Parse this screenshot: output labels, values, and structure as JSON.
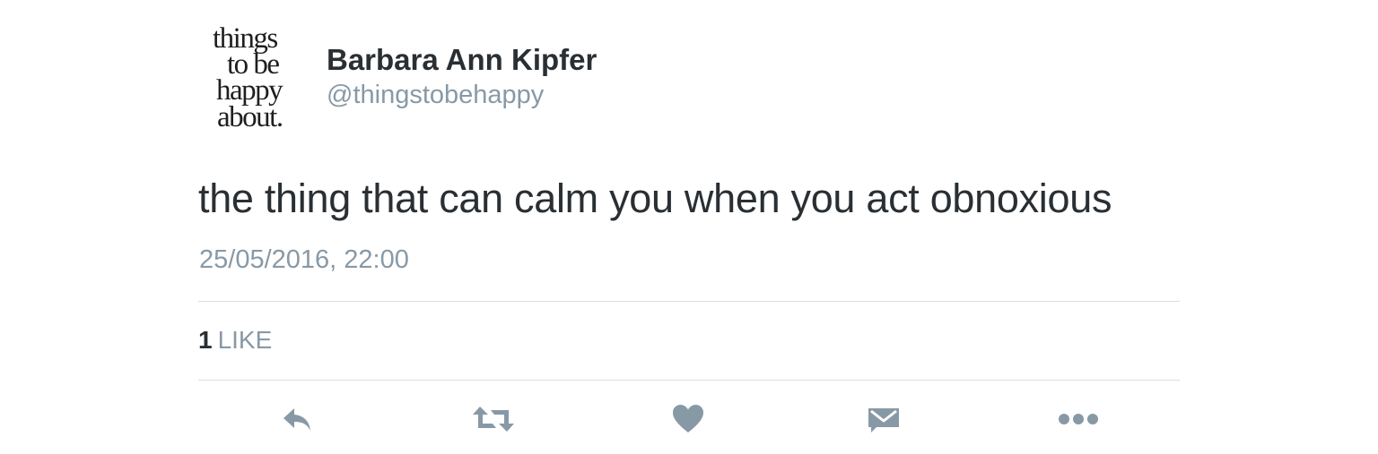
{
  "author": {
    "avatar_text": [
      "things",
      "to be",
      "happy",
      "about."
    ],
    "display_name": "Barbara Ann Kipfer",
    "handle": "@thingstobehappy"
  },
  "tweet": {
    "text": "the thing that can calm you when you act obnoxious",
    "timestamp": "25/05/2016, 22:00"
  },
  "stats": {
    "likes_count": "1",
    "likes_label": "LIKE"
  },
  "actions": [
    {
      "name": "reply",
      "icon": "reply-icon"
    },
    {
      "name": "retweet",
      "icon": "retweet-icon"
    },
    {
      "name": "like",
      "icon": "heart-icon"
    },
    {
      "name": "direct-message",
      "icon": "envelope-icon"
    },
    {
      "name": "more",
      "icon": "more-dots-icon"
    }
  ],
  "colors": {
    "primary_text": "#292f33",
    "secondary_text": "#8899a6",
    "icon": "#8899a6",
    "divider": "#d9dee2"
  }
}
